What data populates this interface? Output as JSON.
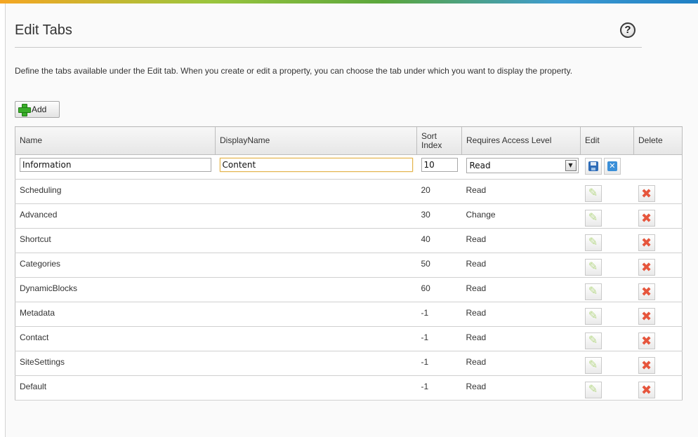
{
  "page": {
    "title": "Edit Tabs",
    "help_label": "?",
    "description": "Define the tabs available under the Edit tab. When you create or edit a property, you can choose the tab under which you want to display the property."
  },
  "toolbar": {
    "add_label": "Add"
  },
  "table": {
    "headers": {
      "name": "Name",
      "display_name": "DisplayName",
      "sort_index": "Sort Index",
      "access_level": "Requires Access Level",
      "edit": "Edit",
      "delete": "Delete"
    },
    "edit_row": {
      "name": "Information",
      "display_name": "Content",
      "sort_index": "10",
      "access_level": "Read"
    },
    "rows": [
      {
        "name": "Scheduling",
        "display_name": "",
        "sort_index": "20",
        "access_level": "Read"
      },
      {
        "name": "Advanced",
        "display_name": "",
        "sort_index": "30",
        "access_level": "Change"
      },
      {
        "name": "Shortcut",
        "display_name": "",
        "sort_index": "40",
        "access_level": "Read"
      },
      {
        "name": "Categories",
        "display_name": "",
        "sort_index": "50",
        "access_level": "Read"
      },
      {
        "name": "DynamicBlocks",
        "display_name": "",
        "sort_index": "60",
        "access_level": "Read"
      },
      {
        "name": "Metadata",
        "display_name": "",
        "sort_index": "-1",
        "access_level": "Read"
      },
      {
        "name": "Contact",
        "display_name": "",
        "sort_index": "-1",
        "access_level": "Read"
      },
      {
        "name": "SiteSettings",
        "display_name": "",
        "sort_index": "-1",
        "access_level": "Read"
      },
      {
        "name": "Default",
        "display_name": "",
        "sort_index": "-1",
        "access_level": "Read"
      }
    ]
  },
  "icons": {
    "edit": "pencil-icon",
    "delete": "delete-x-icon",
    "save": "save-icon",
    "cancel": "cancel-icon",
    "add": "plus-icon",
    "help": "help-icon"
  }
}
